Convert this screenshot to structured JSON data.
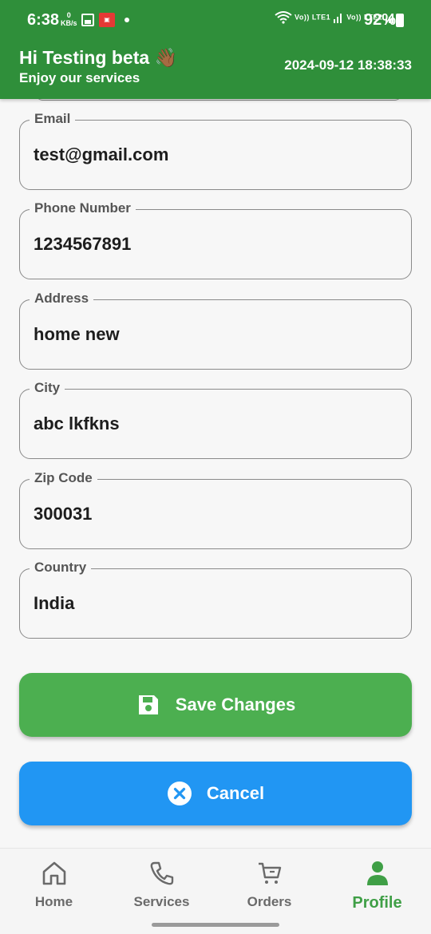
{
  "status_bar": {
    "time": "6:38",
    "kbs_value": "0",
    "kbs_unit": "KB/s",
    "net_label_1": "Vo)) LTE1",
    "net_label_2": "Vo)) LTE2",
    "battery": "92%"
  },
  "header": {
    "greeting": "Hi Testing beta 👋🏾",
    "subtitle": "Enjoy our services",
    "datetime": "2024-09-12 18:38:33",
    "color": "#2f8f3a"
  },
  "form": {
    "email": {
      "label": "Email",
      "value": "test@gmail.com"
    },
    "phone": {
      "label": "Phone Number",
      "value": "1234567891"
    },
    "address": {
      "label": "Address",
      "value": "home new"
    },
    "city": {
      "label": "City",
      "value": "abc lkfkns"
    },
    "zip": {
      "label": "Zip Code",
      "value": "300031"
    },
    "country": {
      "label": "Country",
      "value": "India"
    }
  },
  "buttons": {
    "save_label": "Save Changes",
    "save_icon": "save-icon",
    "save_color": "#4caf50",
    "cancel_label": "Cancel",
    "cancel_icon": "cancel-circle-icon",
    "cancel_color": "#2196f3"
  },
  "nav": {
    "items": [
      {
        "label": "Home",
        "icon": "home-icon",
        "active": false
      },
      {
        "label": "Services",
        "icon": "phone-icon",
        "active": false
      },
      {
        "label": "Orders",
        "icon": "cart-icon",
        "active": false
      },
      {
        "label": "Profile",
        "icon": "person-icon",
        "active": true
      }
    ],
    "active_color": "#3f9f46"
  }
}
